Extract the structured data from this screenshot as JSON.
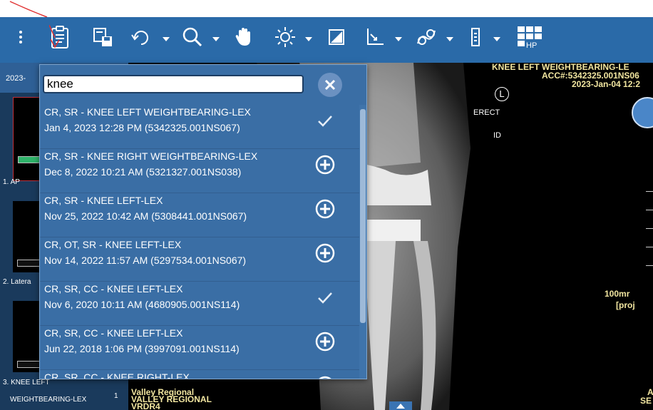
{
  "toolbar": {
    "icons": [
      "more-vert-icon",
      "clipboard-icon",
      "save-series-icon",
      "rotate-icon",
      "zoom-icon",
      "pan-hand-icon",
      "brightness-icon",
      "invert-icon",
      "measure-icon",
      "annotate-icon",
      "layout-icon",
      "hanging-protocol-icon"
    ],
    "hp_label": "HP"
  },
  "strip": {
    "date_label": "2023-",
    "thumbs": [
      {
        "label": "1. AP",
        "progress": 0.35
      },
      {
        "label": "2. Latera",
        "progress": 0
      },
      {
        "label": "3. KNEE LEFT",
        "progress": 0
      }
    ],
    "footer_label": "WEIGHTBEARING-LEX",
    "footer_count": "1"
  },
  "viewer": {
    "header_line1": "KNEE LEFT WEIGHTBEARING-LE",
    "header_line2": "ACC#:5342325.001NS06",
    "header_line3": "2023-Jan-04 12:2",
    "side_marker": "L",
    "position_line1": "ERECT",
    "position_line2": "ID",
    "scale_line1": "100mr",
    "scale_line2": "[proj",
    "footer_line1": "Valley Regional",
    "footer_line2": "VALLEY REGIONAL",
    "footer_line3": "VRDR4",
    "footer_right1": "A",
    "footer_right2": "SE"
  },
  "search": {
    "value": "knee",
    "results": [
      {
        "title": "CR, SR - KNEE LEFT WEIGHTBEARING-LEX",
        "detail": "Jan 4, 2023 12:28 PM (5342325.001NS067)",
        "status": "loaded"
      },
      {
        "title": "CR, SR - KNEE RIGHT WEIGHTBEARING-LEX",
        "detail": "Dec 8, 2022 10:21 AM (5321327.001NS038)",
        "status": "add"
      },
      {
        "title": "CR, SR - KNEE LEFT-LEX",
        "detail": "Nov 25, 2022 10:42 AM (5308441.001NS067)",
        "status": "add"
      },
      {
        "title": "CR, OT, SR - KNEE LEFT-LEX",
        "detail": "Nov 14, 2022 11:57 AM (5297534.001NS067)",
        "status": "add"
      },
      {
        "title": "CR, SR, CC - KNEE LEFT-LEX",
        "detail": "Nov 6, 2020 10:11 AM (4680905.001NS114)",
        "status": "loaded"
      },
      {
        "title": "CR, SR, CC - KNEE LEFT-LEX",
        "detail": "Jun 22, 2018 1:06 PM (3997091.001NS114)",
        "status": "add"
      },
      {
        "title": "CR, SR, CC - KNEE RIGHT-LEX",
        "detail": "",
        "status": "add"
      }
    ]
  }
}
